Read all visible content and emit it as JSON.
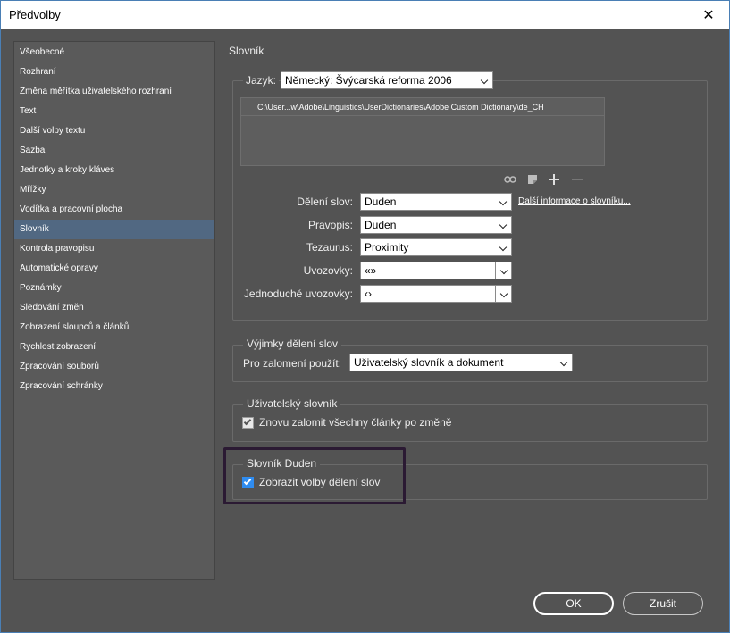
{
  "window": {
    "title": "Předvolby",
    "close_glyph": "✕"
  },
  "sidebar": {
    "items": [
      {
        "label": "Všeobecné"
      },
      {
        "label": "Rozhraní"
      },
      {
        "label": "Změna měřítka uživatelského rozhraní"
      },
      {
        "label": "Text"
      },
      {
        "label": "Další volby textu"
      },
      {
        "label": "Sazba"
      },
      {
        "label": "Jednotky a kroky kláves"
      },
      {
        "label": "Mřížky"
      },
      {
        "label": "Vodítka a pracovní plocha"
      },
      {
        "label": "Slovník",
        "selected": true
      },
      {
        "label": "Kontrola pravopisu"
      },
      {
        "label": "Automatické opravy"
      },
      {
        "label": "Poznámky"
      },
      {
        "label": "Sledování změn"
      },
      {
        "label": "Zobrazení sloupců a článků"
      },
      {
        "label": "Rychlost zobrazení"
      },
      {
        "label": "Zpracování souborů"
      },
      {
        "label": "Zpracování schránky"
      }
    ]
  },
  "panel": {
    "title": "Slovník",
    "language": {
      "label": "Jazyk:",
      "value": "Německý: Švýcarská reforma 2006"
    },
    "dictionary_list": [
      "C:\\User...w\\Adobe\\Linguistics\\UserDictionaries\\Adobe Custom Dictionary\\de_CH"
    ],
    "toolbar_icons": [
      "link-icon",
      "new-dictionary-icon",
      "add-icon",
      "remove-icon"
    ],
    "hyphenation": {
      "label": "Dělení slov:",
      "value": "Duden"
    },
    "more_info_link": "Další informace o slovníku...",
    "spelling": {
      "label": "Pravopis:",
      "value": "Duden"
    },
    "thesaurus": {
      "label": "Tezaurus:",
      "value": "Proximity"
    },
    "quotes": {
      "label": "Uvozovky:",
      "value": "«»"
    },
    "single_quotes": {
      "label": "Jednoduché uvozovky:",
      "value": "‹›"
    },
    "exceptions": {
      "legend": "Výjimky dělení slov",
      "label": "Pro zalomení použít:",
      "value": "Uživatelský slovník a dokument"
    },
    "user_dictionary": {
      "legend": "Uživatelský slovník",
      "checkbox_label": "Znovu zalomit všechny články po změně",
      "checked": true
    },
    "duden": {
      "legend": "Slovník Duden",
      "checkbox_label": "Zobrazit volby dělení slov",
      "checked": true
    }
  },
  "buttons": {
    "ok": "OK",
    "cancel": "Zrušit"
  },
  "colors": {
    "background": "#535353",
    "sidebar_selected": "#516882",
    "checkbox_accent": "#2f8cf0",
    "highlight_border": "#2b1a33"
  }
}
